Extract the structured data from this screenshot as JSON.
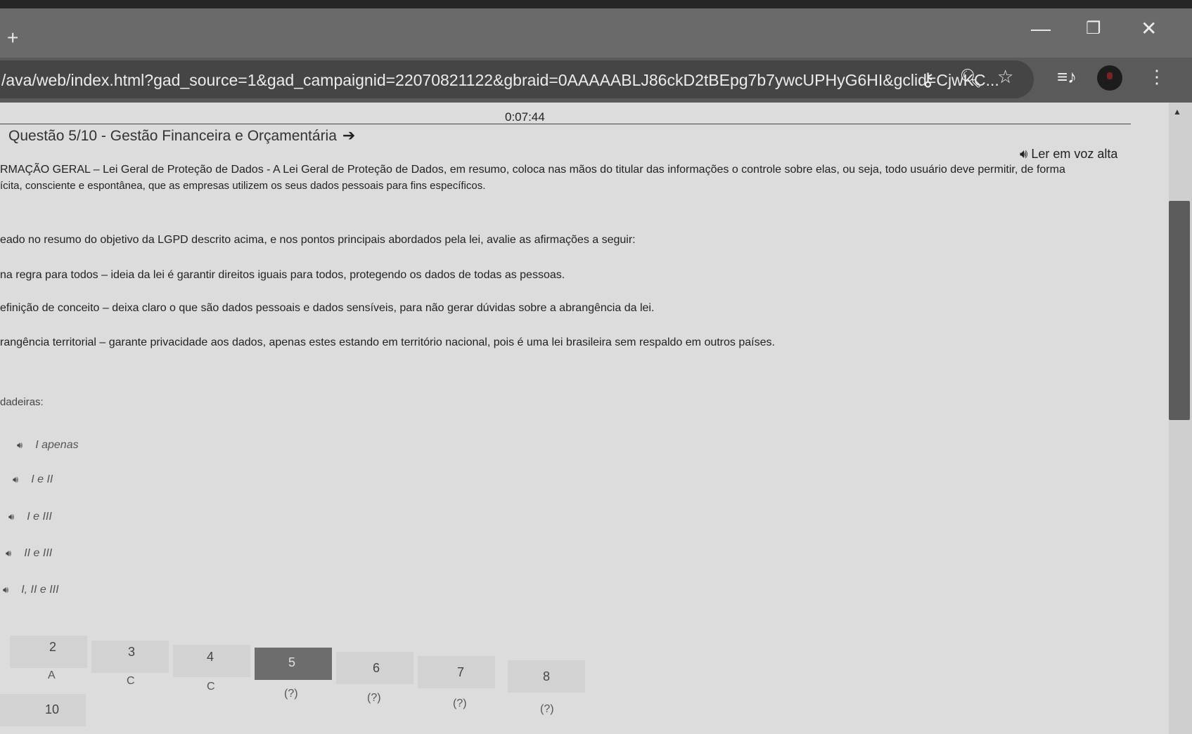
{
  "browser": {
    "url": "/ava/web/index.html?gad_source=1&gad_campaignid=22070821122&gbraid=0AAAAABLJ86ckD2tBEpg7b7ywcUPHyG6HI&gclid=CjwKC..."
  },
  "quiz": {
    "timer": "0:07:44",
    "title": "Questão 5/10 - Gestão Financeira e Orçamentária",
    "read_aloud": "Ler em voz alta",
    "body_line1": "RMAÇÃO GERAL – Lei Geral de Proteção de Dados - A Lei Geral de Proteção de Dados, em resumo, coloca nas mãos do titular das informações o controle sobre elas, ou seja, todo usuário deve permitir, de forma",
    "body_line2": "ícita, consciente e espontânea, que as empresas utilizem os seus dados pessoais para fins específicos.",
    "prompt": "eado no resumo do objetivo da LGPD descrito acima, e nos pontos principais abordados pela lei, avalie as afirmações a seguir:",
    "statement_1": "na regra para todos – ideia da lei é garantir direitos iguais para todos, protegendo os dados de todas as pessoas.",
    "statement_2": "efinição de conceito – deixa claro o que são dados pessoais e dados sensíveis, para não gerar dúvidas sobre a abrangência da lei.",
    "statement_3": "rangência territorial – garante privacidade aos dados, apenas estes estando em território nacional, pois é uma lei brasileira sem respaldo em outros países.",
    "choices_label": "dadeiras:",
    "options": [
      "I apenas",
      "I e II",
      "I e III",
      "II e III",
      "I, II e III"
    ]
  },
  "pager": {
    "numbers": [
      "2",
      "3",
      "4",
      "5",
      "6",
      "7",
      "8"
    ],
    "answers": [
      "A",
      "C",
      "C",
      "(?)",
      "(?)",
      "(?)",
      "(?)"
    ],
    "extra": "10",
    "active": "5"
  },
  "colors": {
    "page_bg": "#dcdcdc",
    "chrome_bg": "#5a5a5a",
    "active_cell": "#6d6d6d"
  }
}
